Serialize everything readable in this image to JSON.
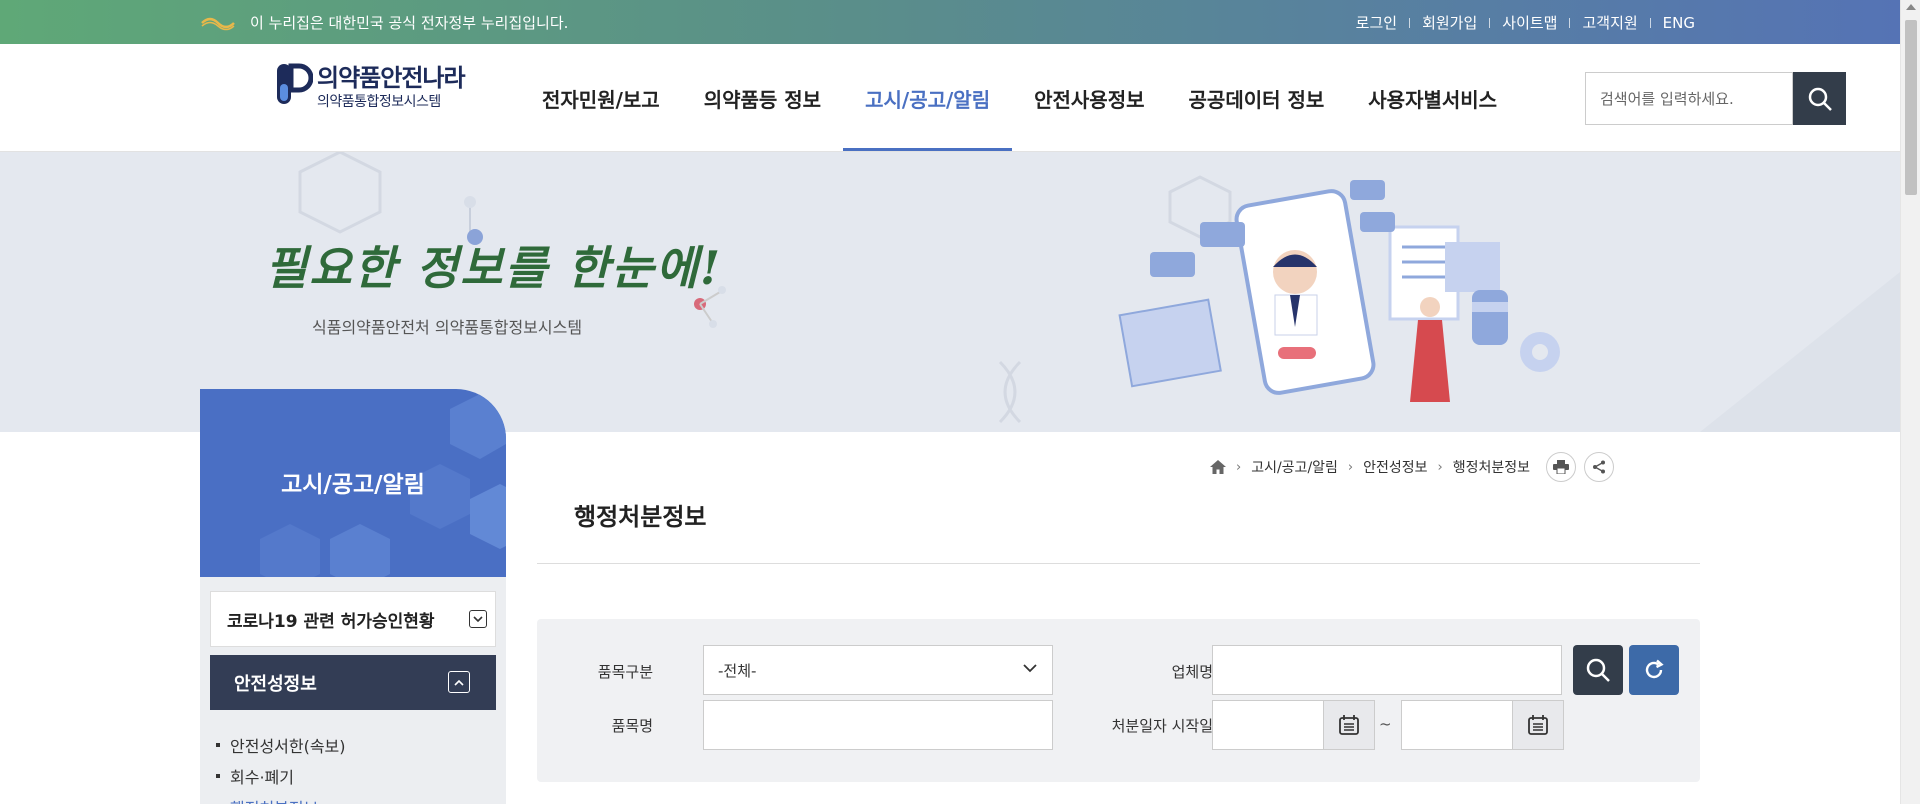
{
  "gov_bar": {
    "notice": "이 누리집은 대한민국 공식 전자정부 누리집입니다.",
    "links": [
      "로그인",
      "회원가입",
      "사이트맵",
      "고객지원",
      "ENG"
    ]
  },
  "header": {
    "logo_main": "의약품안전나라",
    "logo_sub": "의약품통합정보시스템",
    "nav": [
      "전자민원/보고",
      "의약품등 정보",
      "고시/공고/알림",
      "안전사용정보",
      "공공데이터 정보",
      "사용자별서비스"
    ],
    "active_nav": "고시/공고/알림",
    "search_placeholder": "검색어를 입력하세요."
  },
  "banner": {
    "headline": "필요한 정보를 한눈에!",
    "subtitle": "식품의약품안전처 의약품통합정보시스템"
  },
  "sidebar": {
    "title": "고시/공고/알림",
    "dropdown_value": "코로나19 관련 허가승인현황",
    "active_section": "안전성정보",
    "items": [
      "안전성서한(속보)",
      "회수·폐기",
      "행정처분정보"
    ]
  },
  "breadcrumb": [
    "고시/공고/알림",
    "안전성정보",
    "행정처분정보"
  ],
  "page": {
    "title": "행정처분정보"
  },
  "filter": {
    "item_type_label": "품목구분",
    "item_type_value": "-전체-",
    "company_label": "업체명",
    "company_value": "",
    "product_label": "품목명",
    "product_value": "",
    "date_start_label": "처분일자 시작일",
    "date_start_value": "",
    "date_end_value": "",
    "range_separator": "~"
  },
  "colors": {
    "accent": "#4a70c2",
    "dark_nav": "#333d55",
    "search_btn": "#333d4a",
    "reset_btn": "#3d6aa8"
  }
}
